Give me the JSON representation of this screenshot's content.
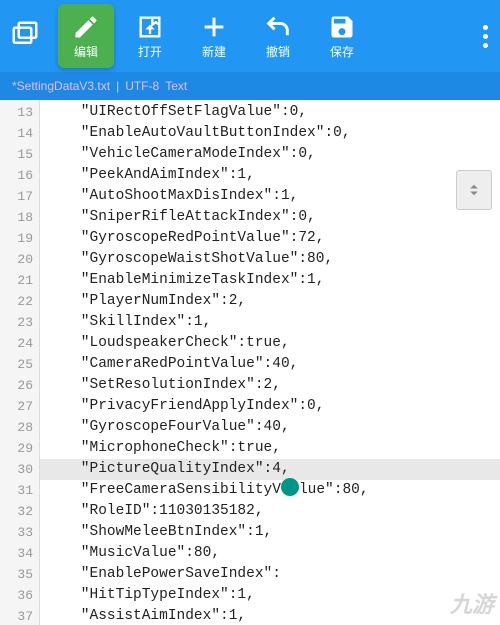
{
  "toolbar": {
    "edit": "编辑",
    "open": "打开",
    "new": "新建",
    "undo": "撤销",
    "save": "保存"
  },
  "tab": {
    "filename": "*SettingDataV3.txt",
    "encoding": "UTF-8",
    "filetype": "Text"
  },
  "lines": [
    {
      "n": 13,
      "t": "    \"UIRectOffSetFlagValue\":0,"
    },
    {
      "n": 14,
      "t": "    \"EnableAutoVaultButtonIndex\":0,"
    },
    {
      "n": 15,
      "t": "    \"VehicleCameraModeIndex\":0,"
    },
    {
      "n": 16,
      "t": "    \"PeekAndAimIndex\":1,"
    },
    {
      "n": 17,
      "t": "    \"AutoShootMaxDisIndex\":1,"
    },
    {
      "n": 18,
      "t": "    \"SniperRifleAttackIndex\":0,"
    },
    {
      "n": 19,
      "t": "    \"GyroscopeRedPointValue\":72,"
    },
    {
      "n": 20,
      "t": "    \"GyroscopeWaistShotValue\":80,"
    },
    {
      "n": 21,
      "t": "    \"EnableMinimizeTaskIndex\":1,"
    },
    {
      "n": 22,
      "t": "    \"PlayerNumIndex\":2,"
    },
    {
      "n": 23,
      "t": "    \"SkillIndex\":1,"
    },
    {
      "n": 24,
      "t": "    \"LoudspeakerCheck\":true,"
    },
    {
      "n": 25,
      "t": "    \"CameraRedPointValue\":40,"
    },
    {
      "n": 26,
      "t": "    \"SetResolutionIndex\":2,"
    },
    {
      "n": 27,
      "t": "    \"PrivacyFriendApplyIndex\":0,"
    },
    {
      "n": 28,
      "t": "    \"GyroscopeFourValue\":40,"
    },
    {
      "n": 29,
      "t": "    \"MicrophoneCheck\":true,"
    },
    {
      "n": 30,
      "t": "    \"PictureQualityIndex\":4,",
      "hl": true
    },
    {
      "n": 31,
      "t": "    \"FreeCameraSensibilityV",
      "t2": "lue\":80,",
      "cursor": true
    },
    {
      "n": 32,
      "t": "    \"RoleID\":11030135182,"
    },
    {
      "n": 33,
      "t": "    \"ShowMeleeBtnIndex\":1,"
    },
    {
      "n": 34,
      "t": "    \"MusicValue\":80,"
    },
    {
      "n": 35,
      "t": "    \"EnablePowerSaveIndex\":"
    },
    {
      "n": 36,
      "t": "    \"HitTipTypeIndex\":1,"
    },
    {
      "n": 37,
      "t": "    \"AssistAimIndex\":1,"
    }
  ],
  "watermark": "九游"
}
